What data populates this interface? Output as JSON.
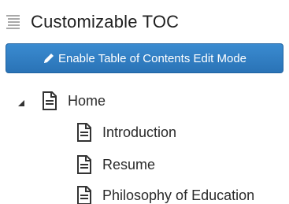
{
  "header": {
    "title": "Customizable TOC",
    "icon": "toc-list-icon"
  },
  "toolbar": {
    "edit_label": "Enable Table of Contents Edit Mode",
    "edit_icon": "pencil-icon",
    "button_color": "#2f7dc2"
  },
  "tree": {
    "root": {
      "label": "Home",
      "icon": "document-icon",
      "expanded": true
    },
    "children": [
      {
        "label": "Introduction",
        "icon": "document-icon"
      },
      {
        "label": "Resume",
        "icon": "document-icon"
      },
      {
        "label": "Philosophy of Education",
        "icon": "document-icon"
      }
    ]
  }
}
